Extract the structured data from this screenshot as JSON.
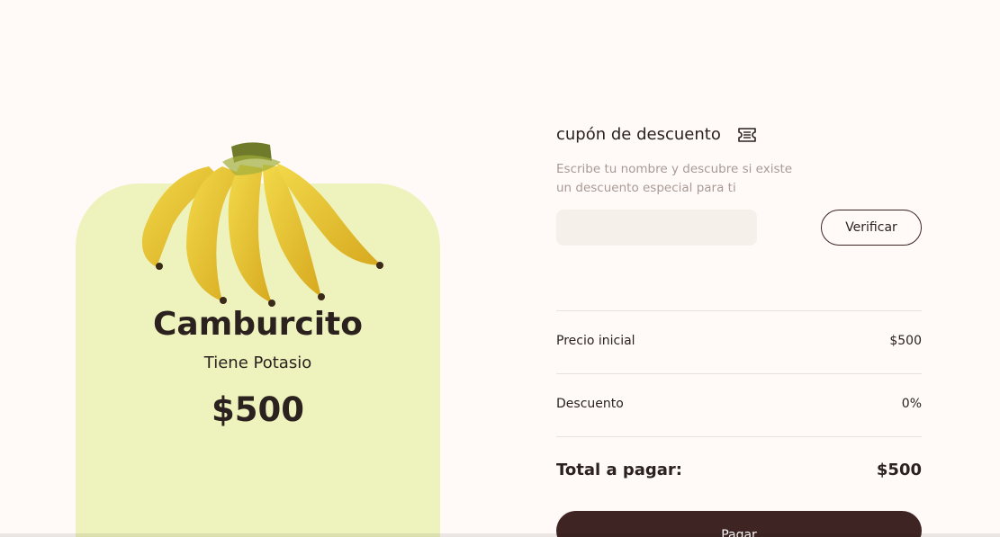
{
  "product": {
    "name": "Camburcito",
    "subtitle": "Tiene Potasio",
    "price": "$500",
    "image": "banana-bunch"
  },
  "coupon": {
    "title": "cupón de descuento",
    "icon": "ticket-icon",
    "description": "Escribe tu nombre y descubre si existe un descuento especial para ti",
    "input_value": "",
    "input_placeholder": "",
    "verify_label": "Verificar"
  },
  "summary": {
    "initial_price_label": "Precio inicial",
    "initial_price_value": "$500",
    "discount_label": "Descuento",
    "discount_value": "0%",
    "total_label": "Total a pagar:",
    "total_value": "$500"
  },
  "pay_label": "Pagar",
  "colors": {
    "background": "#fffaf8",
    "card": "#eef3bd",
    "primary": "#3e2523",
    "text": "#2b211e",
    "muted": "#a79a95",
    "input_bg": "#f5f0ea"
  }
}
